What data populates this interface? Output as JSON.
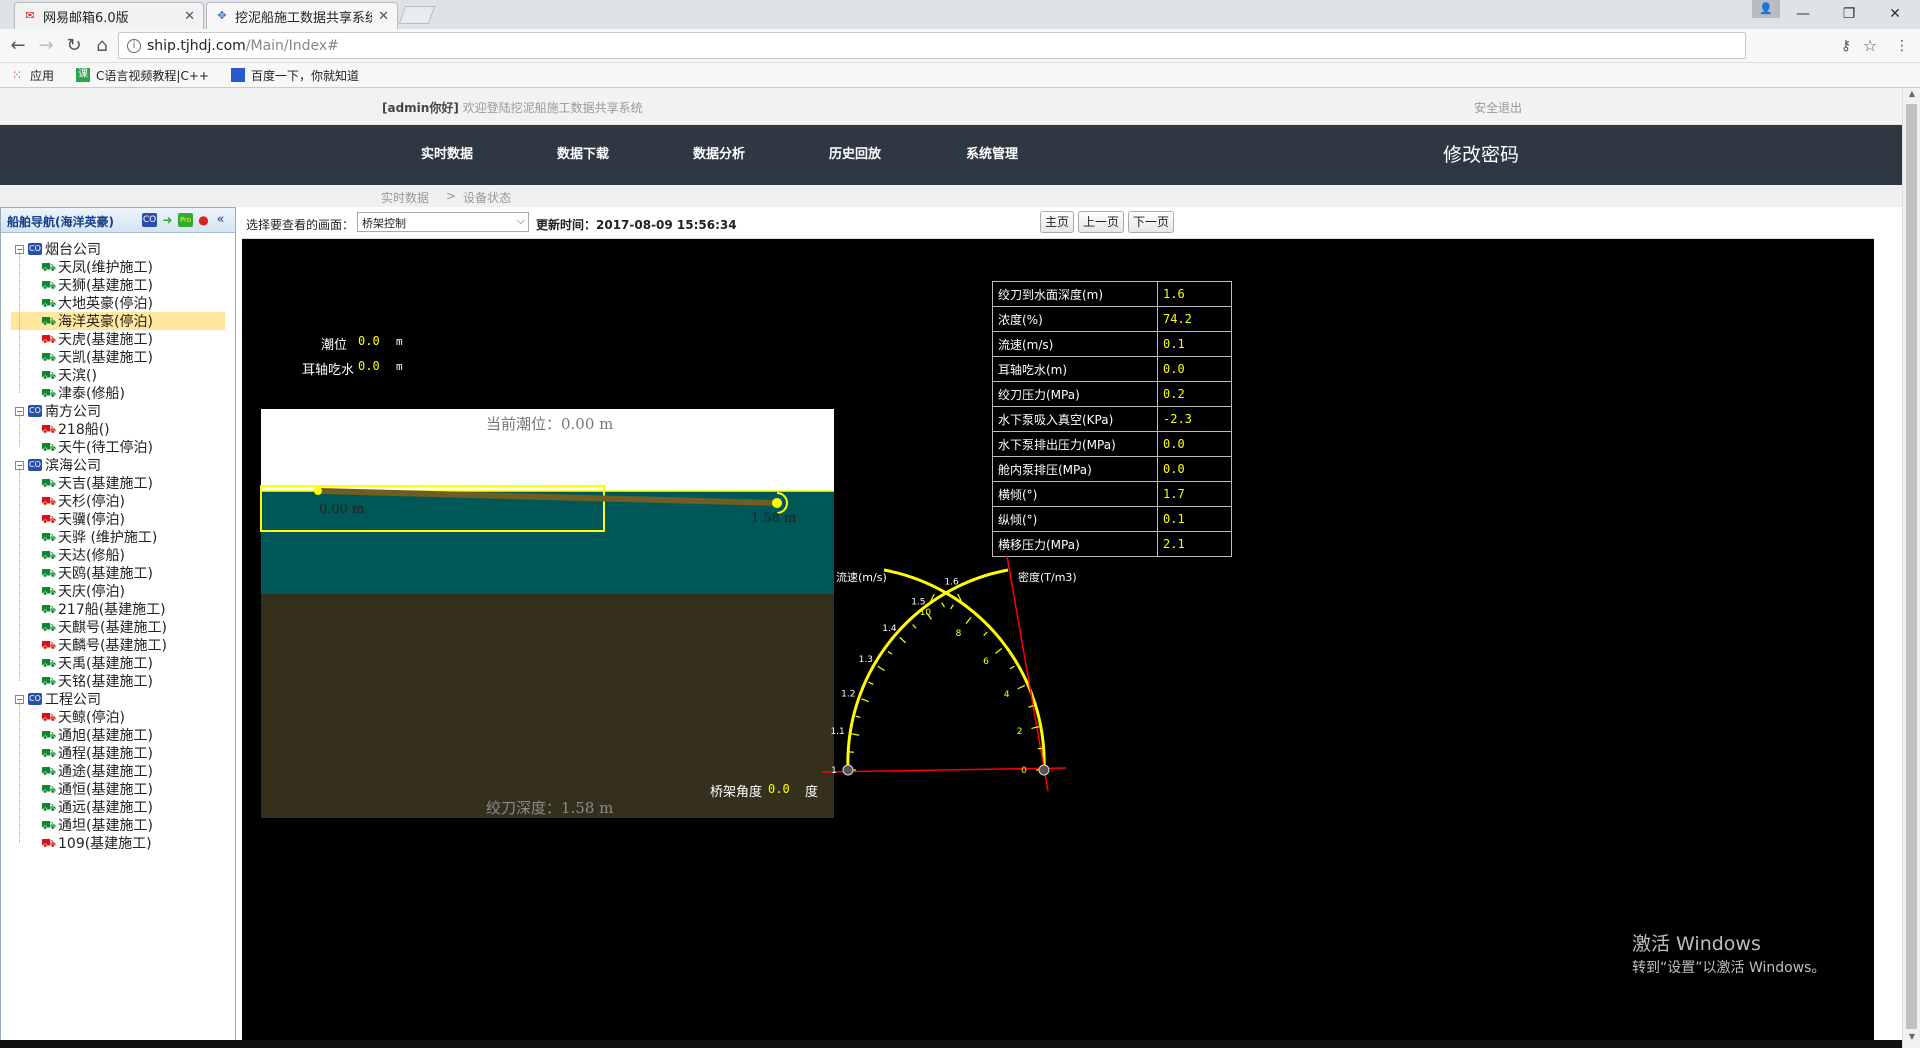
{
  "browser": {
    "tabs": [
      {
        "title": "网易邮箱6.0版",
        "icon": "mail-icon",
        "active": false
      },
      {
        "title": "挖泥船施工数据共享系统",
        "icon": "site-icon",
        "active": true
      }
    ],
    "url_host": "ship.tjhdj.com",
    "url_path": "/Main/Index#",
    "bookmarks": [
      {
        "label": "应用",
        "icon": "apps-grid-icon"
      },
      {
        "label": "C语言视频教程|C++",
        "icon": "c-course-icon"
      },
      {
        "label": "百度一下，你就知道",
        "icon": "baidu-paw-icon"
      }
    ]
  },
  "header": {
    "user": "[admin你好]",
    "welcome": "欢迎登陆挖泥船施工数据共享系统",
    "logout": "安全退出"
  },
  "nav": {
    "items": [
      "实时数据",
      "数据下载",
      "数据分析",
      "历史回放",
      "系统管理"
    ],
    "change_password": "修改密码"
  },
  "breadcrumb": {
    "root": "实时数据",
    "sep": ">",
    "current": "设备状态"
  },
  "sidebar": {
    "title": "船舶导航(海洋英豪)",
    "companies": [
      {
        "name": "烟台公司",
        "ships": [
          {
            "name": "天凤(维护施工)",
            "color": "green"
          },
          {
            "name": "天狮(基建施工)",
            "color": "green"
          },
          {
            "name": "大地英豪(停泊)",
            "color": "green"
          },
          {
            "name": "海洋英豪(停泊)",
            "color": "green",
            "selected": true
          },
          {
            "name": "天虎(基建施工)",
            "color": "red"
          },
          {
            "name": "天凯(基建施工)",
            "color": "green"
          },
          {
            "name": "天滨()",
            "color": "green"
          },
          {
            "name": "津泰(修船)",
            "color": "green"
          }
        ]
      },
      {
        "name": "南方公司",
        "ships": [
          {
            "name": "218船()",
            "color": "red"
          },
          {
            "name": "天牛(待工停泊)",
            "color": "green"
          }
        ]
      },
      {
        "name": "滨海公司",
        "ships": [
          {
            "name": "天吉(基建施工)",
            "color": "green"
          },
          {
            "name": "天杉(停泊)",
            "color": "red"
          },
          {
            "name": "天骥(停泊)",
            "color": "red"
          },
          {
            "name": "天骅 (维护施工)",
            "color": "green"
          },
          {
            "name": "天达(修船)",
            "color": "green"
          },
          {
            "name": "天鸥(基建施工)",
            "color": "green"
          },
          {
            "name": "天庆(停泊)",
            "color": "green"
          },
          {
            "name": "217船(基建施工)",
            "color": "green"
          },
          {
            "name": "天麒号(基建施工)",
            "color": "green"
          },
          {
            "name": "天麟号(基建施工)",
            "color": "red"
          },
          {
            "name": "天禹(基建施工)",
            "color": "green"
          },
          {
            "name": "天铭(基建施工)",
            "color": "green"
          }
        ]
      },
      {
        "name": "工程公司",
        "ships": [
          {
            "name": "天鲸(停泊)",
            "color": "red"
          },
          {
            "name": "通旭(基建施工)",
            "color": "green"
          },
          {
            "name": "通程(基建施工)",
            "color": "green"
          },
          {
            "name": "通途(基建施工)",
            "color": "green"
          },
          {
            "name": "通恒(基建施工)",
            "color": "green"
          },
          {
            "name": "通远(基建施工)",
            "color": "green"
          },
          {
            "name": "通坦(基建施工)",
            "color": "green"
          },
          {
            "name": "109(基建施工)",
            "color": "red"
          }
        ]
      }
    ]
  },
  "content": {
    "select_label": "选择要查看的画面：",
    "select_value": "桥架控制",
    "update_label": "更新时间：2017-08-09 15:56:34",
    "buttons": {
      "home": "主页",
      "prev": "上一页",
      "next": "下一页"
    }
  },
  "stage": {
    "tide_label": "潮位",
    "tide_value": "0.0",
    "tide_unit": "m",
    "trunnion_label": "耳轴吃水",
    "trunnion_value": "0.0",
    "trunnion_unit": "m",
    "current_tide_text": "当前潮位：0.00 m",
    "left_depth_text": "0.00 m",
    "right_depth_text": "1.58 m",
    "cutter_depth_text": "绞刀深度：1.58 m",
    "ladder_angle_label": "桥架角度",
    "ladder_angle_value": "0.0",
    "ladder_angle_unit": "度",
    "table": [
      {
        "k": "绞刀到水面深度(m)",
        "v": "1.6"
      },
      {
        "k": "浓度(%)",
        "v": "74.2"
      },
      {
        "k": "流速(m/s)",
        "v": "0.1"
      },
      {
        "k": "耳轴吃水(m)",
        "v": "0.0"
      },
      {
        "k": "绞刀压力(MPa)",
        "v": "0.2"
      },
      {
        "k": "水下泵吸入真空(KPa)",
        "v": "-2.3"
      },
      {
        "k": "水下泵排出压力(MPa)",
        "v": "0.0"
      },
      {
        "k": "舱内泵排压(MPa)",
        "v": "0.0"
      },
      {
        "k": "横倾(°)",
        "v": "1.7"
      },
      {
        "k": "纵倾(°)",
        "v": "0.1"
      },
      {
        "k": "横移压力(MPa)",
        "v": "2.1"
      }
    ],
    "gauge": {
      "left_title": "流速(m/s)",
      "right_title": "密度(T/m3)",
      "left_ticks": [
        "10",
        "8",
        "6",
        "4",
        "2",
        "0"
      ],
      "right_ticks": [
        "1.6",
        "1.5",
        "1.4",
        "1.3",
        "1.2",
        "1.1",
        "1"
      ],
      "velocity_value": 0.1,
      "density_value": 1.0
    }
  },
  "watermark": {
    "line1": "激活 Windows",
    "line2": "转到“设置”以激活 Windows。"
  }
}
